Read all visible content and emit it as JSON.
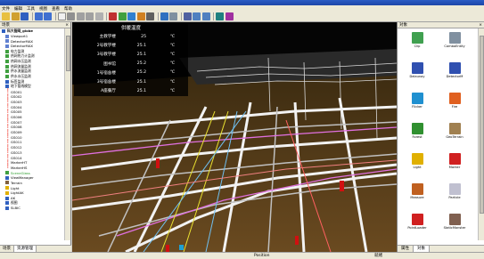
{
  "menu": [
    "文件",
    "编辑",
    "工具",
    "视图",
    "查看",
    "帮助"
  ],
  "left_panel": {
    "header": "场景",
    "close_glyph": "×",
    "tree": [
      {
        "label": "科大管网_globe",
        "icon": "globe-icon",
        "color": "#3060c0",
        "bold": true
      },
      {
        "label": "Viewport1",
        "icon": "viewport-icon",
        "color": "#6080d0"
      },
      {
        "label": "DetectorMAX",
        "icon": "detector-icon",
        "color": "#6080d0"
      },
      {
        "label": "DetectorMAX",
        "icon": "detector-icon",
        "color": "#6080d0"
      },
      {
        "label": "电力监测",
        "icon": "layer-icon",
        "color": "#40a040"
      },
      {
        "label": "热网热力计监测",
        "icon": "layer-icon",
        "color": "#40a040"
      },
      {
        "label": "热网水压监测",
        "icon": "layer-icon",
        "color": "#40a040"
      },
      {
        "label": "热网流量监测",
        "icon": "layer-icon",
        "color": "#40a040"
      },
      {
        "label": "供水流量监测",
        "icon": "layer-icon",
        "color": "#40a040"
      },
      {
        "label": "供水水压监测",
        "icon": "layer-icon",
        "color": "#40a040"
      },
      {
        "label": "标签监测",
        "icon": "label-icon",
        "color": "#3060c0"
      },
      {
        "label": "地下管线模型",
        "icon": "model-icon",
        "color": "#3060c0"
      },
      {
        "label": "GS001",
        "icon": "pin-icon",
        "color": "#d01010"
      },
      {
        "label": "GS002",
        "icon": "pin-icon",
        "color": "#d01010"
      },
      {
        "label": "GS003",
        "icon": "pin-icon",
        "color": "#d01010"
      },
      {
        "label": "GS004",
        "icon": "pin-icon",
        "color": "#d01010"
      },
      {
        "label": "GS005",
        "icon": "pin-icon",
        "color": "#d01010"
      },
      {
        "label": "GS006",
        "icon": "pin-icon",
        "color": "#d01010"
      },
      {
        "label": "GS007",
        "icon": "pin-icon",
        "color": "#d01010"
      },
      {
        "label": "GS008",
        "icon": "pin-icon",
        "color": "#d01010"
      },
      {
        "label": "GS009",
        "icon": "pin-icon",
        "color": "#d01010"
      },
      {
        "label": "GS010",
        "icon": "pin-icon",
        "color": "#d01010"
      },
      {
        "label": "GS011",
        "icon": "pin-icon",
        "color": "#d01010"
      },
      {
        "label": "GS012",
        "icon": "pin-icon",
        "color": "#d01010"
      },
      {
        "label": "GS013",
        "icon": "pin-icon",
        "color": "#d01010"
      },
      {
        "label": "GS014",
        "icon": "pin-icon",
        "color": "#d01010"
      },
      {
        "label": "MarkerHT",
        "icon": "pin-icon",
        "color": "#d01010"
      },
      {
        "label": "MarkerHS",
        "icon": "pin-icon",
        "color": "#d01010"
      },
      {
        "label": "SceneGlass",
        "icon": "scene-icon",
        "color": "#40a040",
        "highlight": true
      },
      {
        "label": "ViewManager",
        "icon": "manager-icon",
        "color": "#3060c0"
      },
      {
        "label": "Terrain",
        "icon": "terrain-icon",
        "color": "#806040"
      },
      {
        "label": "Light",
        "icon": "light-icon",
        "color": "#e0b000"
      },
      {
        "label": "LightAK",
        "icon": "light-icon",
        "color": "#e0b000"
      },
      {
        "label": "AK",
        "icon": "object-icon",
        "color": "#3060c0"
      },
      {
        "label": "视图",
        "icon": "view-icon",
        "color": "#3060c0"
      },
      {
        "label": "SLBIC",
        "icon": "object-icon",
        "color": "#3060c0"
      }
    ],
    "tabs": [
      "场景",
      "资源管理"
    ]
  },
  "temperature_panel": {
    "title": "供暖温度",
    "unit": "℃",
    "rows": [
      {
        "name": "主教学楼",
        "value": "25"
      },
      {
        "name": "2号教学楼",
        "value": "25.1"
      },
      {
        "name": "3号教学楼",
        "value": "25.1"
      },
      {
        "name": "图书馆",
        "value": "25.2"
      },
      {
        "name": "1号宿舍楼",
        "value": "25.2"
      },
      {
        "name": "3号宿舍楼",
        "value": "25.1"
      },
      {
        "name": "A座餐厅",
        "value": "25.1"
      }
    ]
  },
  "right_panel": {
    "header": "对象",
    "close_glyph": "×",
    "objects": [
      {
        "label": "Clip",
        "icon": "clip-icon",
        "color": "#40a050"
      },
      {
        "label": "ComboEntity",
        "icon": "combo-entity-icon",
        "color": "#8090a0"
      },
      {
        "label": "Delaunay",
        "icon": "delaunay-icon",
        "color": "#3050b0"
      },
      {
        "label": "DetectorM",
        "icon": "detector-icon",
        "color": "#3050b0"
      },
      {
        "label": "Flicker",
        "icon": "flicker-icon",
        "color": "#2090d0"
      },
      {
        "label": "Fire",
        "icon": "fire-icon",
        "color": "#e06020"
      },
      {
        "label": "Forest",
        "icon": "forest-icon",
        "color": "#309030"
      },
      {
        "label": "GeoTerrain",
        "icon": "geo-terrain-icon",
        "color": "#a08050"
      },
      {
        "label": "Light",
        "icon": "light-icon",
        "color": "#e0b000"
      },
      {
        "label": "Marker",
        "icon": "marker-icon",
        "color": "#d02020"
      },
      {
        "label": "Measure",
        "icon": "measure-icon",
        "color": "#c06020"
      },
      {
        "label": "Particle",
        "icon": "particle-icon",
        "color": "#c0c0d0"
      },
      {
        "label": "PointLoader",
        "icon": "point-loader-icon",
        "color": "#d02020"
      },
      {
        "label": "StaticMonster",
        "icon": "static-monster-icon",
        "color": "#806050"
      }
    ],
    "tabs": [
      "属性",
      "对象"
    ]
  },
  "status_bar": {
    "position_label": "Position",
    "status_text": "就绪"
  }
}
